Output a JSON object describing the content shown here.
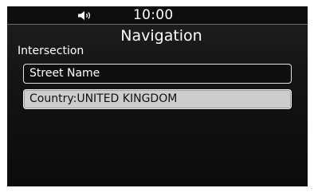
{
  "status_bar": {
    "time": "10:00",
    "volume_icon": "speaker-volume-icon"
  },
  "header": {
    "title": "Navigation"
  },
  "section": {
    "label": "Intersection"
  },
  "fields": {
    "street_name": "Street Name",
    "country": "Country:UNITED KINGDOM"
  },
  "colors": {
    "background": "#141414",
    "text": "#ffffff",
    "selected_field_bg": "#cdcdcd",
    "selected_field_text": "#111111",
    "border": "#e2e2e2"
  }
}
